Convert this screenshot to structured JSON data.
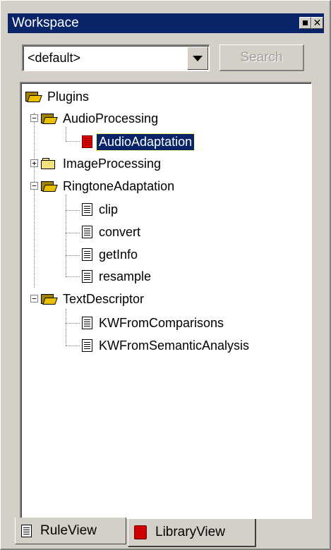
{
  "window": {
    "title": "Workspace"
  },
  "toolbar": {
    "combo_value": "<default>",
    "search_label": "Search"
  },
  "tree": {
    "root": "Plugins",
    "nodes": [
      {
        "label": "AudioProcessing",
        "type": "folder-open",
        "expanded": true
      },
      {
        "label": "AudioAdaptation",
        "type": "plugin-red",
        "selected": true
      },
      {
        "label": "ImageProcessing",
        "type": "folder-closed",
        "expanded": false
      },
      {
        "label": "RingtoneAdaptation",
        "type": "folder-open",
        "expanded": true
      },
      {
        "label": "clip",
        "type": "doc"
      },
      {
        "label": "convert",
        "type": "doc"
      },
      {
        "label": "getInfo",
        "type": "doc"
      },
      {
        "label": "resample",
        "type": "doc"
      },
      {
        "label": "TextDescriptor",
        "type": "folder-open",
        "expanded": true
      },
      {
        "label": "KWFromComparisons",
        "type": "doc"
      },
      {
        "label": "KWFromSemanticAnalysis",
        "type": "doc"
      }
    ]
  },
  "tabs": [
    {
      "label": "RuleView",
      "active": false
    },
    {
      "label": "LibraryView",
      "active": true
    }
  ],
  "colors": {
    "titlebar": "#0a246a",
    "selection": "#0a246a",
    "chrome": "#d4d0c8"
  }
}
